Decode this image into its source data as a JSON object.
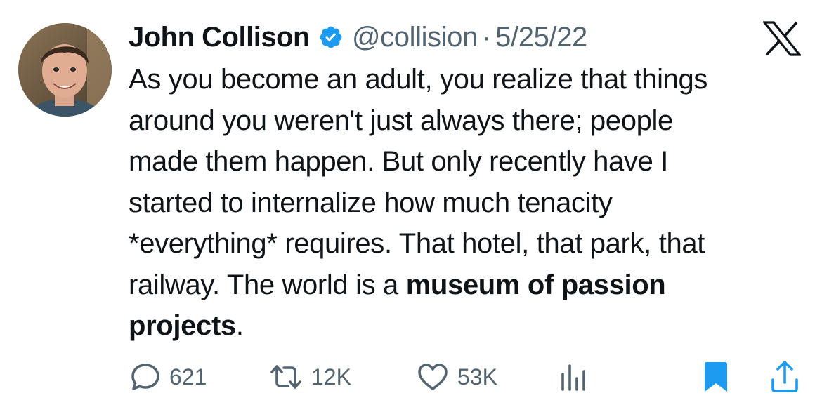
{
  "tweet": {
    "author": {
      "name": "John Collison",
      "handle": "@collision",
      "verified": true,
      "avatar_icon": "profile-photo"
    },
    "separator": "·",
    "date": "5/25/22",
    "platform_icon": "x-logo-icon",
    "text": {
      "line1": "As you become an adult, you realize that things",
      "line2": "around you weren't just always there; people",
      "line3": "made them happen. But only recently have I",
      "line4": "started to internalize how much tenacity",
      "line5": "*everything* requires. That hotel, that park, that",
      "line6a": "railway. The world is a ",
      "line6b": "museum of passion",
      "line7a": "projects",
      "line7b": "."
    },
    "stats": {
      "replies": "621",
      "retweets": "12K",
      "likes": "53K"
    },
    "colors": {
      "verified_blue": "#1d9bf0",
      "bookmark_blue": "#1d9bf0",
      "secondary_text": "#536471"
    }
  }
}
